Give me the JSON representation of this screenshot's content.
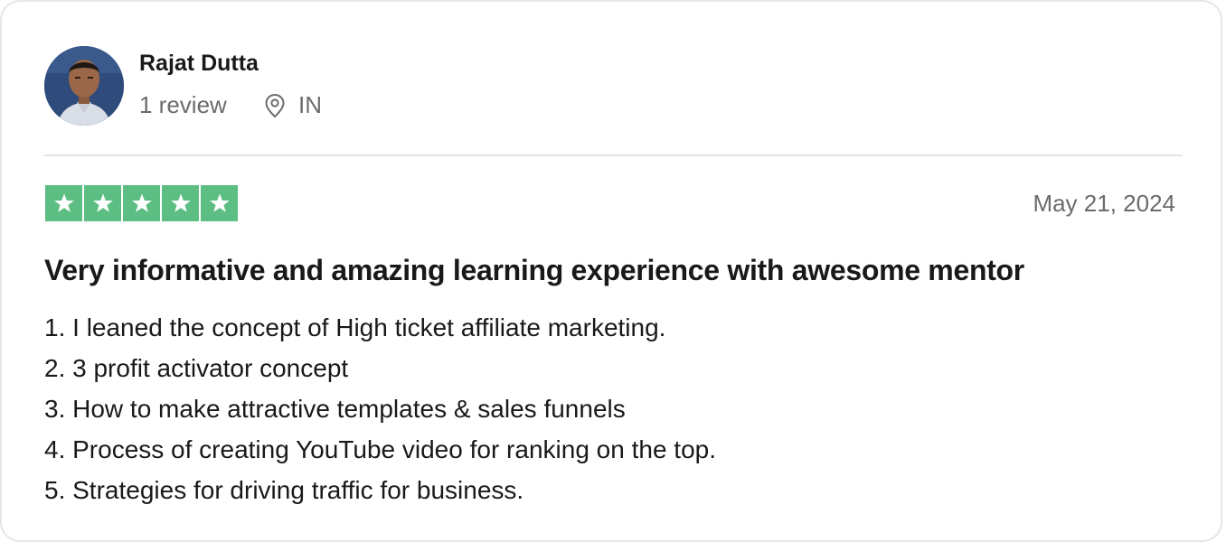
{
  "reviewer": {
    "name": "Rajat Dutta",
    "review_count": "1 review",
    "location": "IN",
    "location_icon": "map-pin-icon"
  },
  "review": {
    "rating": 5,
    "max_rating": 5,
    "date": "May 21, 2024",
    "title": "Very informative and amazing learning experience with awesome mentor",
    "lines": [
      "1. I leaned the concept of High ticket affiliate marketing.",
      "2. 3 profit activator concept",
      "3. How to make attractive templates & sales funnels",
      "4. Process of creating YouTube video for ranking on the top.",
      "5. Strategies for driving traffic for business."
    ]
  },
  "colors": {
    "star_green": "#5cbe82",
    "text_primary": "#191919",
    "text_secondary": "#6b6b6b"
  }
}
